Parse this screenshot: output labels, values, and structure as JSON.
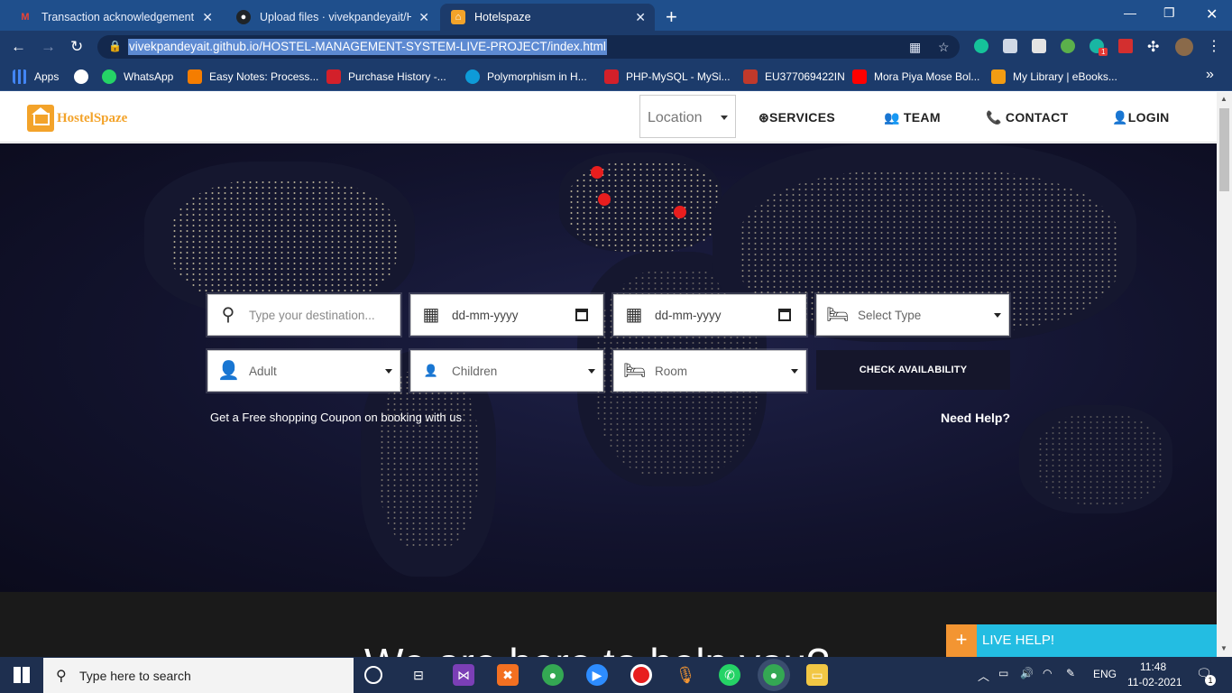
{
  "browser": {
    "tabs": [
      {
        "title": "Transaction acknowledgement - ‹",
        "favicon": "gmail-icon",
        "color": "#ea4335"
      },
      {
        "title": "Upload files · vivekpandeyait/HO",
        "favicon": "github-icon",
        "color": "#24292e"
      },
      {
        "title": "Hotelspaze",
        "favicon": "hostelspaze-icon",
        "color": "#f3a32a"
      }
    ],
    "url": "vivekpandeyait.github.io/HOSTEL-MANAGEMENT-SYSTEM-LIVE-PROJECT/index.html",
    "extension_badge": "1",
    "bookmarks": [
      {
        "label": "Apps",
        "color": "#4285f4"
      },
      {
        "label": "",
        "color": "#ffffff"
      },
      {
        "label": "WhatsApp",
        "color": "#25d366"
      },
      {
        "label": "Easy Notes: Process...",
        "color": "#f57d00"
      },
      {
        "label": "Purchase History -...",
        "color": "#d3202a"
      },
      {
        "label": "Polymorphism in H...",
        "color": "#0e9bd8"
      },
      {
        "label": "PHP-MySQL - MySi...",
        "color": "#d3202a"
      },
      {
        "label": "EU377069422IN",
        "color": "#c0392b"
      },
      {
        "label": "Mora Piya Mose Bol...",
        "color": "#ff0000"
      },
      {
        "label": "My Library | eBooks...",
        "color": "#f39c12"
      }
    ],
    "more_bookmarks": "»"
  },
  "site": {
    "logo_text": "HostelSpaze",
    "location_select": "Location",
    "nav": {
      "services": "SERVICES",
      "team": "TEAM",
      "contact": "CONTACT",
      "login": "LOGIN"
    },
    "form": {
      "destination_placeholder": "Type your destination...",
      "checkin": "dd-mm-yyyy",
      "checkout": "dd-mm-yyyy",
      "type": "Select Type",
      "adult": "Adult",
      "children": "Children",
      "room": "Room",
      "check_button": "CHECK AVAILABILITY"
    },
    "coupon_text": "Get a Free shopping Coupon on booking with us",
    "need_help": "Need Help?",
    "section_heading": "We are here to help you?",
    "live_help": "LIVE HELP!",
    "live_help_plus": "+"
  },
  "taskbar": {
    "search_placeholder": "Type here to search",
    "language": "ENG",
    "time": "11:48",
    "date": "11-02-2021",
    "notification_count": "1"
  }
}
